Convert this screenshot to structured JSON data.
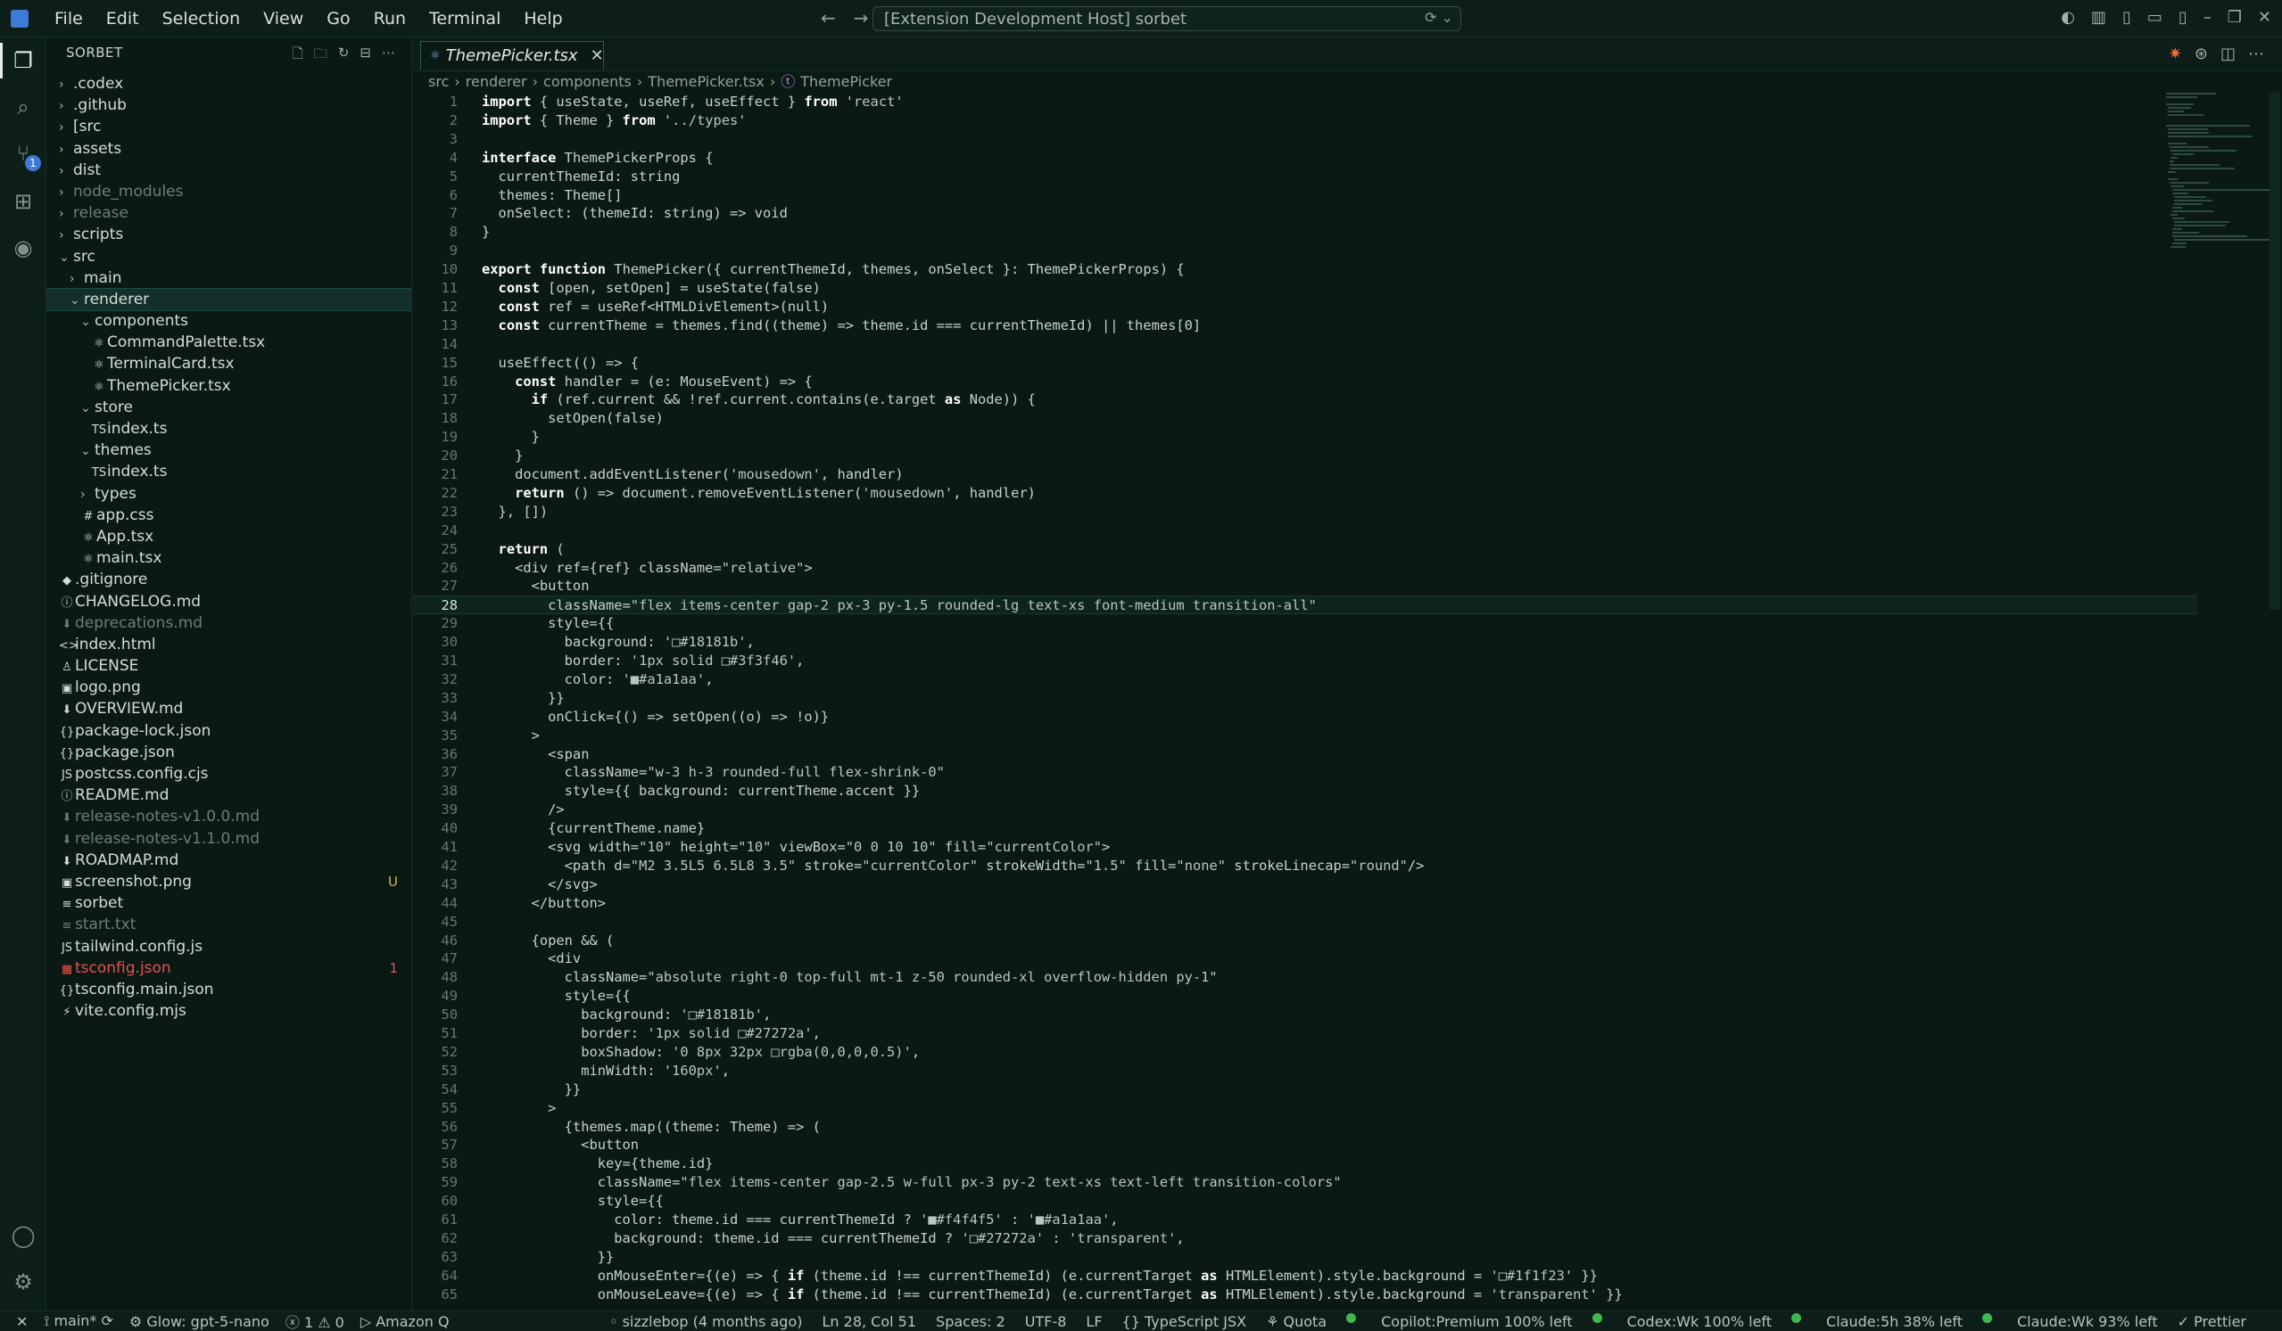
{
  "titlebar": {
    "menu": [
      "File",
      "Edit",
      "Selection",
      "View",
      "Go",
      "Run",
      "Terminal",
      "Help"
    ],
    "command_center": "[Extension Development Host] sorbet"
  },
  "sidebar": {
    "title": "SORBET",
    "items": [
      {
        "label": ".codex",
        "type": "folder",
        "depth": 0,
        "open": false
      },
      {
        "label": ".github",
        "type": "folder",
        "depth": 0,
        "open": false
      },
      {
        "label": "[src",
        "type": "folder",
        "depth": 0,
        "open": false
      },
      {
        "label": "assets",
        "type": "folder",
        "depth": 0,
        "open": false
      },
      {
        "label": "dist",
        "type": "folder",
        "depth": 0,
        "open": false
      },
      {
        "label": "node_modules",
        "type": "folder",
        "depth": 0,
        "open": false,
        "dim": true
      },
      {
        "label": "release",
        "type": "folder",
        "depth": 0,
        "open": false,
        "dim": true
      },
      {
        "label": "scripts",
        "type": "folder",
        "depth": 0,
        "open": false
      },
      {
        "label": "src",
        "type": "folder",
        "depth": 0,
        "open": true
      },
      {
        "label": "main",
        "type": "folder",
        "depth": 1,
        "open": false
      },
      {
        "label": "renderer",
        "type": "folder",
        "depth": 1,
        "open": true,
        "selected": true
      },
      {
        "label": "components",
        "type": "folder",
        "depth": 2,
        "open": true
      },
      {
        "label": "CommandPalette.tsx",
        "type": "file",
        "icon": "⚛",
        "depth": 3
      },
      {
        "label": "TerminalCard.tsx",
        "type": "file",
        "icon": "⚛",
        "depth": 3
      },
      {
        "label": "ThemePicker.tsx",
        "type": "file",
        "icon": "⚛",
        "depth": 3
      },
      {
        "label": "store",
        "type": "folder",
        "depth": 2,
        "open": true
      },
      {
        "label": "index.ts",
        "type": "file",
        "icon": "TS",
        "depth": 3
      },
      {
        "label": "themes",
        "type": "folder",
        "depth": 2,
        "open": true
      },
      {
        "label": "index.ts",
        "type": "file",
        "icon": "TS",
        "depth": 3
      },
      {
        "label": "types",
        "type": "folder",
        "depth": 2,
        "open": false
      },
      {
        "label": "app.css",
        "type": "file",
        "icon": "#",
        "depth": 2
      },
      {
        "label": "App.tsx",
        "type": "file",
        "icon": "⚛",
        "depth": 2
      },
      {
        "label": "main.tsx",
        "type": "file",
        "icon": "⚛",
        "depth": 2
      },
      {
        "label": ".gitignore",
        "type": "file",
        "icon": "◆",
        "depth": 0
      },
      {
        "label": "CHANGELOG.md",
        "type": "file",
        "icon": "ⓘ",
        "depth": 0
      },
      {
        "label": "deprecations.md",
        "type": "file",
        "icon": "⬇",
        "depth": 0,
        "dim": true
      },
      {
        "label": "index.html",
        "type": "file",
        "icon": "<>",
        "depth": 0
      },
      {
        "label": "LICENSE",
        "type": "file",
        "icon": "♙",
        "depth": 0
      },
      {
        "label": "logo.png",
        "type": "file",
        "icon": "▣",
        "depth": 0
      },
      {
        "label": "OVERVIEW.md",
        "type": "file",
        "icon": "⬇",
        "depth": 0
      },
      {
        "label": "package-lock.json",
        "type": "file",
        "icon": "{}",
        "depth": 0
      },
      {
        "label": "package.json",
        "type": "file",
        "icon": "{}",
        "depth": 0
      },
      {
        "label": "postcss.config.cjs",
        "type": "file",
        "icon": "JS",
        "depth": 0
      },
      {
        "label": "README.md",
        "type": "file",
        "icon": "ⓘ",
        "depth": 0
      },
      {
        "label": "release-notes-v1.0.0.md",
        "type": "file",
        "icon": "⬇",
        "depth": 0,
        "dim": true
      },
      {
        "label": "release-notes-v1.1.0.md",
        "type": "file",
        "icon": "⬇",
        "depth": 0,
        "dim": true
      },
      {
        "label": "ROADMAP.md",
        "type": "file",
        "icon": "⬇",
        "depth": 0
      },
      {
        "label": "screenshot.png",
        "type": "file",
        "icon": "▣",
        "depth": 0,
        "tag": "U"
      },
      {
        "label": "sorbet",
        "type": "file",
        "icon": "≡",
        "depth": 0
      },
      {
        "label": "start.txt",
        "type": "file",
        "icon": "≡",
        "depth": 0,
        "dim": true
      },
      {
        "label": "tailwind.config.js",
        "type": "file",
        "icon": "JS",
        "depth": 0
      },
      {
        "label": "tsconfig.json",
        "type": "file",
        "icon": "▦",
        "depth": 0,
        "error": true,
        "tag": "1"
      },
      {
        "label": "tsconfig.main.json",
        "type": "file",
        "icon": "{}",
        "depth": 0
      },
      {
        "label": "vite.config.mjs",
        "type": "file",
        "icon": "⚡",
        "depth": 0
      }
    ]
  },
  "editor": {
    "tab_label": "ThemePicker.tsx",
    "breadcrumb": [
      "src",
      "renderer",
      "components",
      "ThemePicker.tsx",
      "ThemePicker"
    ],
    "current_line": 28,
    "lines": [
      "import { useState, useRef, useEffect } from 'react'",
      "import { Theme } from '../types'",
      "",
      "interface ThemePickerProps {",
      "  currentThemeId: string",
      "  themes: Theme[]",
      "  onSelect: (themeId: string) => void",
      "}",
      "",
      "export function ThemePicker({ currentThemeId, themes, onSelect }: ThemePickerProps) {",
      "  const [open, setOpen] = useState(false)",
      "  const ref = useRef<HTMLDivElement>(null)",
      "  const currentTheme = themes.find((theme) => theme.id === currentThemeId) || themes[0]",
      "",
      "  useEffect(() => {",
      "    const handler = (e: MouseEvent) => {",
      "      if (ref.current && !ref.current.contains(e.target as Node)) {",
      "        setOpen(false)",
      "      }",
      "    }",
      "    document.addEventListener('mousedown', handler)",
      "    return () => document.removeEventListener('mousedown', handler)",
      "  }, [])",
      "",
      "  return (",
      "    <div ref={ref} className=\"relative\">",
      "      <button",
      "        className=\"flex items-center gap-2 px-3 py-1.5 rounded-lg text-xs font-medium transition-all\"",
      "        style={{",
      "          background: '□#18181b',",
      "          border: '1px solid □#3f3f46',",
      "          color: '■#a1a1aa',",
      "        }}",
      "        onClick={() => setOpen((o) => !o)}",
      "      >",
      "        <span",
      "          className=\"w-3 h-3 rounded-full flex-shrink-0\"",
      "          style={{ background: currentTheme.accent }}",
      "        />",
      "        {currentTheme.name}",
      "        <svg width=\"10\" height=\"10\" viewBox=\"0 0 10 10\" fill=\"currentColor\">",
      "          <path d=\"M2 3.5L5 6.5L8 3.5\" stroke=\"currentColor\" strokeWidth=\"1.5\" fill=\"none\" strokeLinecap=\"round\"/>",
      "        </svg>",
      "      </button>",
      "",
      "      {open && (",
      "        <div",
      "          className=\"absolute right-0 top-full mt-1 z-50 rounded-xl overflow-hidden py-1\"",
      "          style={{",
      "            background: '□#18181b',",
      "            border: '1px solid □#27272a',",
      "            boxShadow: '0 8px 32px □rgba(0,0,0,0.5)',",
      "            minWidth: '160px',",
      "          }}",
      "        >",
      "          {themes.map((theme: Theme) => (",
      "            <button",
      "              key={theme.id}",
      "              className=\"flex items-center gap-2.5 w-full px-3 py-2 text-xs text-left transition-colors\"",
      "              style={{",
      "                color: theme.id === currentThemeId ? '■#f4f4f5' : '■#a1a1aa',",
      "                background: theme.id === currentThemeId ? '□#27272a' : 'transparent',",
      "              }}",
      "              onMouseEnter={(e) => { if (theme.id !== currentThemeId) (e.currentTarget as HTMLElement).style.background = '□#1f1f23' }}",
      "              onMouseLeave={(e) => { if (theme.id !== currentThemeId) (e.currentTarget as HTMLElement).style.background = 'transparent' }}"
    ]
  },
  "statusbar": {
    "left": [
      "⟟ main*  ⟳",
      "⚙ Glow: gpt-5-nano",
      "ⓧ 1 ⚠ 0",
      "▷ Amazon Q"
    ],
    "right": [
      "◦ sizzlebop (4 months ago)",
      "Ln 28, Col 51",
      "Spaces: 2",
      "UTF-8",
      "LF",
      "{} TypeScript JSX",
      "⚘ Quota",
      "Copilot:Premium 100% left",
      "Codex:Wk 100% left",
      "Claude:5h 38% left",
      "Claude:Wk 93% left",
      "✓ Prettier"
    ],
    "accent_green": "#3fb950"
  },
  "colors": {
    "background": "#0b1914",
    "panel": "#0d1d17",
    "accent": "#3e7bd8",
    "error": "#e5534b"
  }
}
